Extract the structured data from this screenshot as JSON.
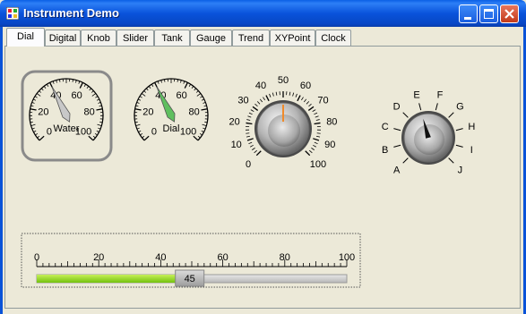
{
  "window": {
    "title": "Instrument Demo"
  },
  "tabs": [
    {
      "label": "Dial",
      "active": true
    },
    {
      "label": "Digital",
      "active": false
    },
    {
      "label": "Knob",
      "active": false
    },
    {
      "label": "Slider",
      "active": false
    },
    {
      "label": "Tank",
      "active": false
    },
    {
      "label": "Gauge",
      "active": false
    },
    {
      "label": "Trend",
      "active": false
    },
    {
      "label": "XYPoint",
      "active": false
    },
    {
      "label": "Clock",
      "active": false
    }
  ],
  "dial_water": {
    "label": "Water",
    "value": 40,
    "range": [
      0,
      100
    ],
    "ticks": [
      "0",
      "20",
      "40",
      "60",
      "80",
      "100"
    ],
    "color": "#c8c8c8"
  },
  "dial_dial": {
    "label": "Dial",
    "value": 40,
    "range": [
      0,
      100
    ],
    "ticks": [
      "0",
      "20",
      "40",
      "60",
      "80",
      "100"
    ],
    "color": "#5fbf5f"
  },
  "knob_numeric": {
    "value": 50,
    "range": [
      0,
      100
    ],
    "ticks": [
      "0",
      "10",
      "20",
      "30",
      "40",
      "50",
      "60",
      "70",
      "80",
      "90",
      "100"
    ],
    "indicator_color": "#f08a2a"
  },
  "knob_letters": {
    "selected": "E",
    "letters": [
      "A",
      "B",
      "C",
      "D",
      "E",
      "F",
      "G",
      "H",
      "I",
      "J"
    ]
  },
  "slider": {
    "value": "45",
    "value_number": 45,
    "range": [
      0,
      100
    ],
    "ticks": [
      "0",
      "20",
      "40",
      "60",
      "80",
      "100"
    ],
    "fill_color": "#8ed81f"
  },
  "colors": {
    "titlebar": "#0a53d8",
    "window_bg": "#ece9d8"
  }
}
